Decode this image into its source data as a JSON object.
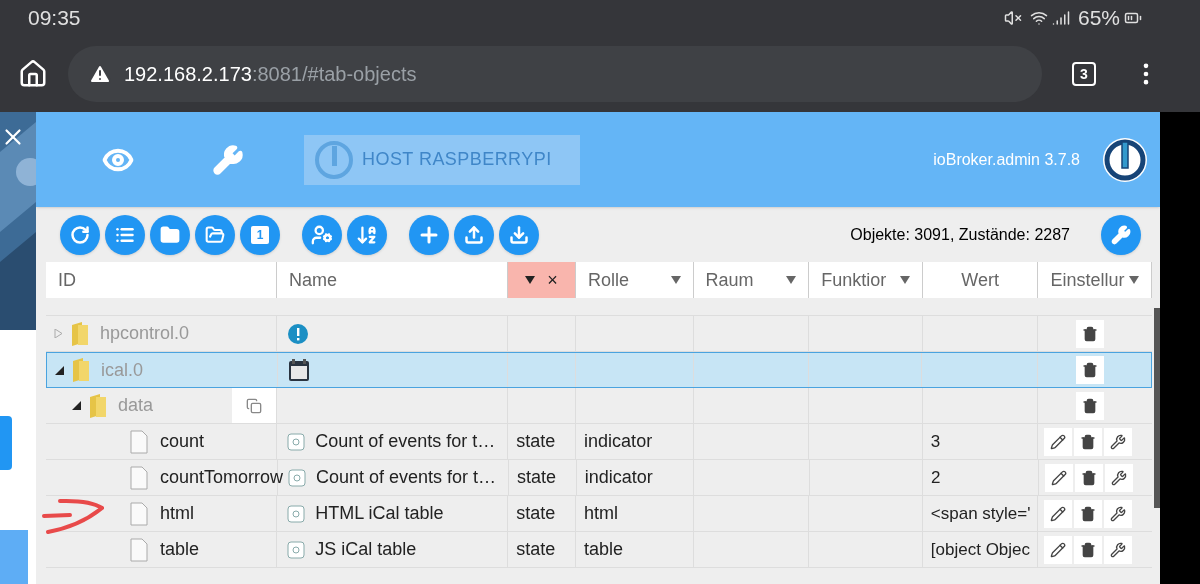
{
  "status_bar": {
    "time": "09:35",
    "battery": "65%"
  },
  "address_bar": {
    "host": "192.168.2.173",
    "path": ":8081/#tab-objects",
    "tab_count": "3"
  },
  "header": {
    "host_button": "HOST RASPBERRYPI",
    "version": "ioBroker.admin 3.7.8"
  },
  "toolbar": {
    "instance_badge": "1",
    "stats": "Objekte: 3091, Zustände: 2287"
  },
  "table": {
    "columns": [
      {
        "label": "ID",
        "filter": false
      },
      {
        "label": "Name",
        "filter": false
      },
      {
        "label": "×",
        "filter": true,
        "active": true
      },
      {
        "label": "Rolle",
        "filter": true,
        "active": false
      },
      {
        "label": "Raum",
        "filter": true,
        "active": false
      },
      {
        "label": "Funktior",
        "filter": true,
        "active": false
      },
      {
        "label": "Wert",
        "filter": false
      },
      {
        "label": "Einstellur",
        "filter": true,
        "active": false
      }
    ],
    "rows": [
      {
        "kind": "folder",
        "id": "hpcontrol.0",
        "expanded": false,
        "selected": false,
        "name_cell": {
          "kind": "info"
        }
      },
      {
        "kind": "folder",
        "id": "ical.0",
        "expanded": true,
        "selected": true,
        "name_cell": {
          "kind": "calendar"
        },
        "children": [
          {
            "kind": "folder",
            "id": "data",
            "expanded": true,
            "selected": false,
            "copy": true,
            "children": [
              {
                "kind": "state",
                "id": "count",
                "selected": false,
                "name": "Count of events for t…",
                "type": "state",
                "role": "indicator",
                "value": "3"
              },
              {
                "kind": "state",
                "id": "countTomorrow",
                "selected": false,
                "name": "Count of events for t…",
                "type": "state",
                "role": "indicator",
                "value": "2"
              },
              {
                "kind": "state",
                "id": "html",
                "selected": false,
                "name": "HTML iCal table",
                "type": "state",
                "role": "html",
                "value": "<span style='"
              },
              {
                "kind": "state",
                "id": "table",
                "selected": false,
                "name": "JS iCal table",
                "type": "state",
                "role": "table",
                "value": "[object Objec"
              }
            ]
          }
        ]
      }
    ]
  }
}
